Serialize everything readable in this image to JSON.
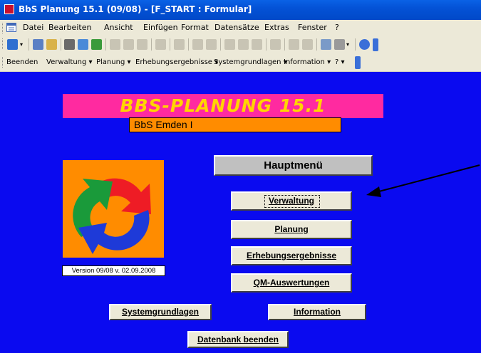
{
  "window": {
    "title": "BbS Planung 15.1 (09/08) - [F_START : Formular]"
  },
  "menubar": {
    "items": [
      {
        "label": "Datei"
      },
      {
        "label": "Bearbeiten"
      },
      {
        "label": "Ansicht"
      },
      {
        "label": "Einfügen"
      },
      {
        "label": "Format"
      },
      {
        "label": "Datensätze"
      },
      {
        "label": "Extras"
      },
      {
        "label": "Fenster"
      },
      {
        "label": "?"
      }
    ]
  },
  "custom_toolbar": {
    "items": [
      {
        "label": "Beenden"
      },
      {
        "label": "Verwaltung ▾"
      },
      {
        "label": "Planung ▾"
      },
      {
        "label": "Erhebungsergebnisse ▾"
      },
      {
        "label": "Systemgrundlagen ▾"
      },
      {
        "label": "Information ▾"
      },
      {
        "label": "? ▾"
      }
    ]
  },
  "form": {
    "app_title": "BBS-PLANUNG 15.1",
    "school_name": "BbS Emden I",
    "version": "Version 09/08 v. 02.09.2008",
    "menu_heading": "Hauptmenü",
    "buttons": {
      "verwaltung": "Verwaltung",
      "planung": "Planung",
      "erhebung": "Erhebungsergebnisse",
      "qm": "QM-Auswertungen",
      "system": "Systemgrundlagen",
      "information": "Information",
      "beenden": "Datenbank beenden"
    }
  },
  "colors": {
    "form_bg": "#0a0af0",
    "banner_bg": "#ff2aa0",
    "title_text": "#ffd500",
    "orange": "#ff8c00"
  }
}
